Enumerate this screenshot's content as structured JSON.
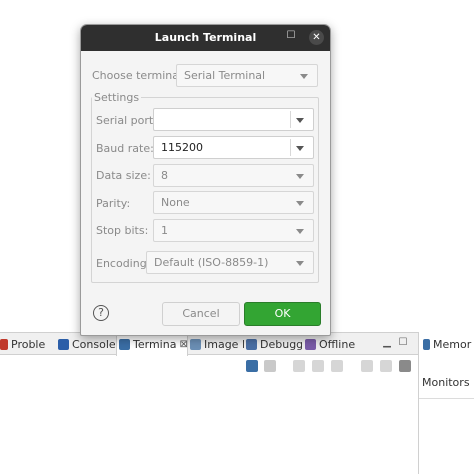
{
  "dialog": {
    "title": "Launch Terminal",
    "maximize_icon": "maximize-icon",
    "close_icon": "close-icon",
    "choose_terminal": {
      "label": "Choose terminal:",
      "value": "Serial Terminal"
    },
    "settings": {
      "group_label": "Settings",
      "serial_port": {
        "label": "Serial port:",
        "value": ""
      },
      "baud_rate": {
        "label": "Baud rate:",
        "value": "115200"
      },
      "data_size": {
        "label": "Data size:",
        "value": "8"
      },
      "parity": {
        "label": "Parity:",
        "value": "None"
      },
      "stop_bits": {
        "label": "Stop bits:",
        "value": "1"
      },
      "encoding": {
        "label": "Encoding:",
        "value": "Default (ISO-8859-1)"
      }
    },
    "help_label": "?",
    "cancel_label": "Cancel",
    "ok_label": "OK",
    "colors": {
      "ok_button": "#33a533",
      "titlebar": "#2f2f2f"
    }
  },
  "views": {
    "tabs": [
      {
        "label": "Proble",
        "icon": "problems-icon",
        "color": "#c0392b"
      },
      {
        "label": "Console",
        "icon": "console-icon",
        "color": "#2b5ea8"
      },
      {
        "label": "Termina",
        "icon": "terminal-icon",
        "color": "#3a6ea5",
        "active": true,
        "close": "⊠"
      },
      {
        "label": "Image I",
        "icon": "image-info-icon",
        "color": "#6b8fb5"
      },
      {
        "label": "Debugg",
        "icon": "debugger-icon",
        "color": "#4a6fa5"
      },
      {
        "label": "Offline",
        "icon": "offline-icon",
        "color": "#7a5ca8"
      }
    ],
    "minimize_icon": "minimize-icon",
    "maximize_icon": "maximize-icon",
    "right_tab": {
      "label": "Memor",
      "icon": "memory-icon"
    },
    "monitors_label": "Monitors"
  }
}
